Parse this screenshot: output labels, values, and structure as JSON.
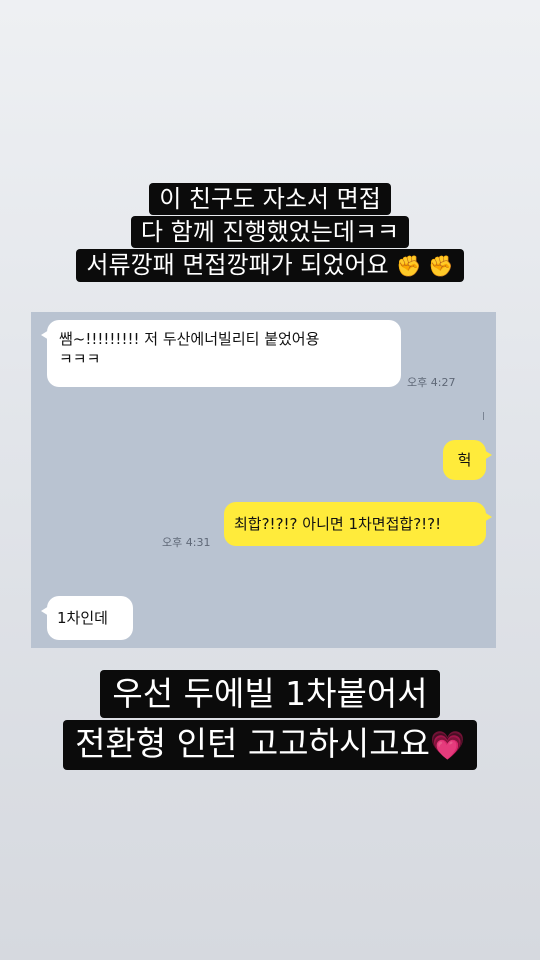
{
  "top_caption": {
    "line1": "이 친구도 자소서 면접",
    "line2": "다 함께 진행했었는데ㅋㅋ",
    "line3": "서류깡패 면접깡패가 되었어요",
    "emoji": "✊ ✊"
  },
  "chat": {
    "messages": [
      {
        "sender": "other",
        "text": "쌤~!!!!!!!!! 저 두산에너빌리티 붙었어용\nㅋㅋㅋ",
        "time": "오후 4:27"
      },
      {
        "sender": "me",
        "text": "헉"
      },
      {
        "sender": "me",
        "text": "최합?!?!? 아니면 1차면접합?!?!",
        "time": "오후 4:31"
      },
      {
        "sender": "other",
        "text": "1차인데"
      }
    ]
  },
  "bottom_caption": {
    "line1": "우선 두에빌 1차붙어서",
    "line2": "전환형 인턴 고고하시고요",
    "emoji": "💗"
  },
  "colors": {
    "chat_background": "#b9c3d1",
    "sent_bubble": "#ffeb3b",
    "received_bubble": "#ffffff",
    "caption_background": "#0b0b0b"
  }
}
